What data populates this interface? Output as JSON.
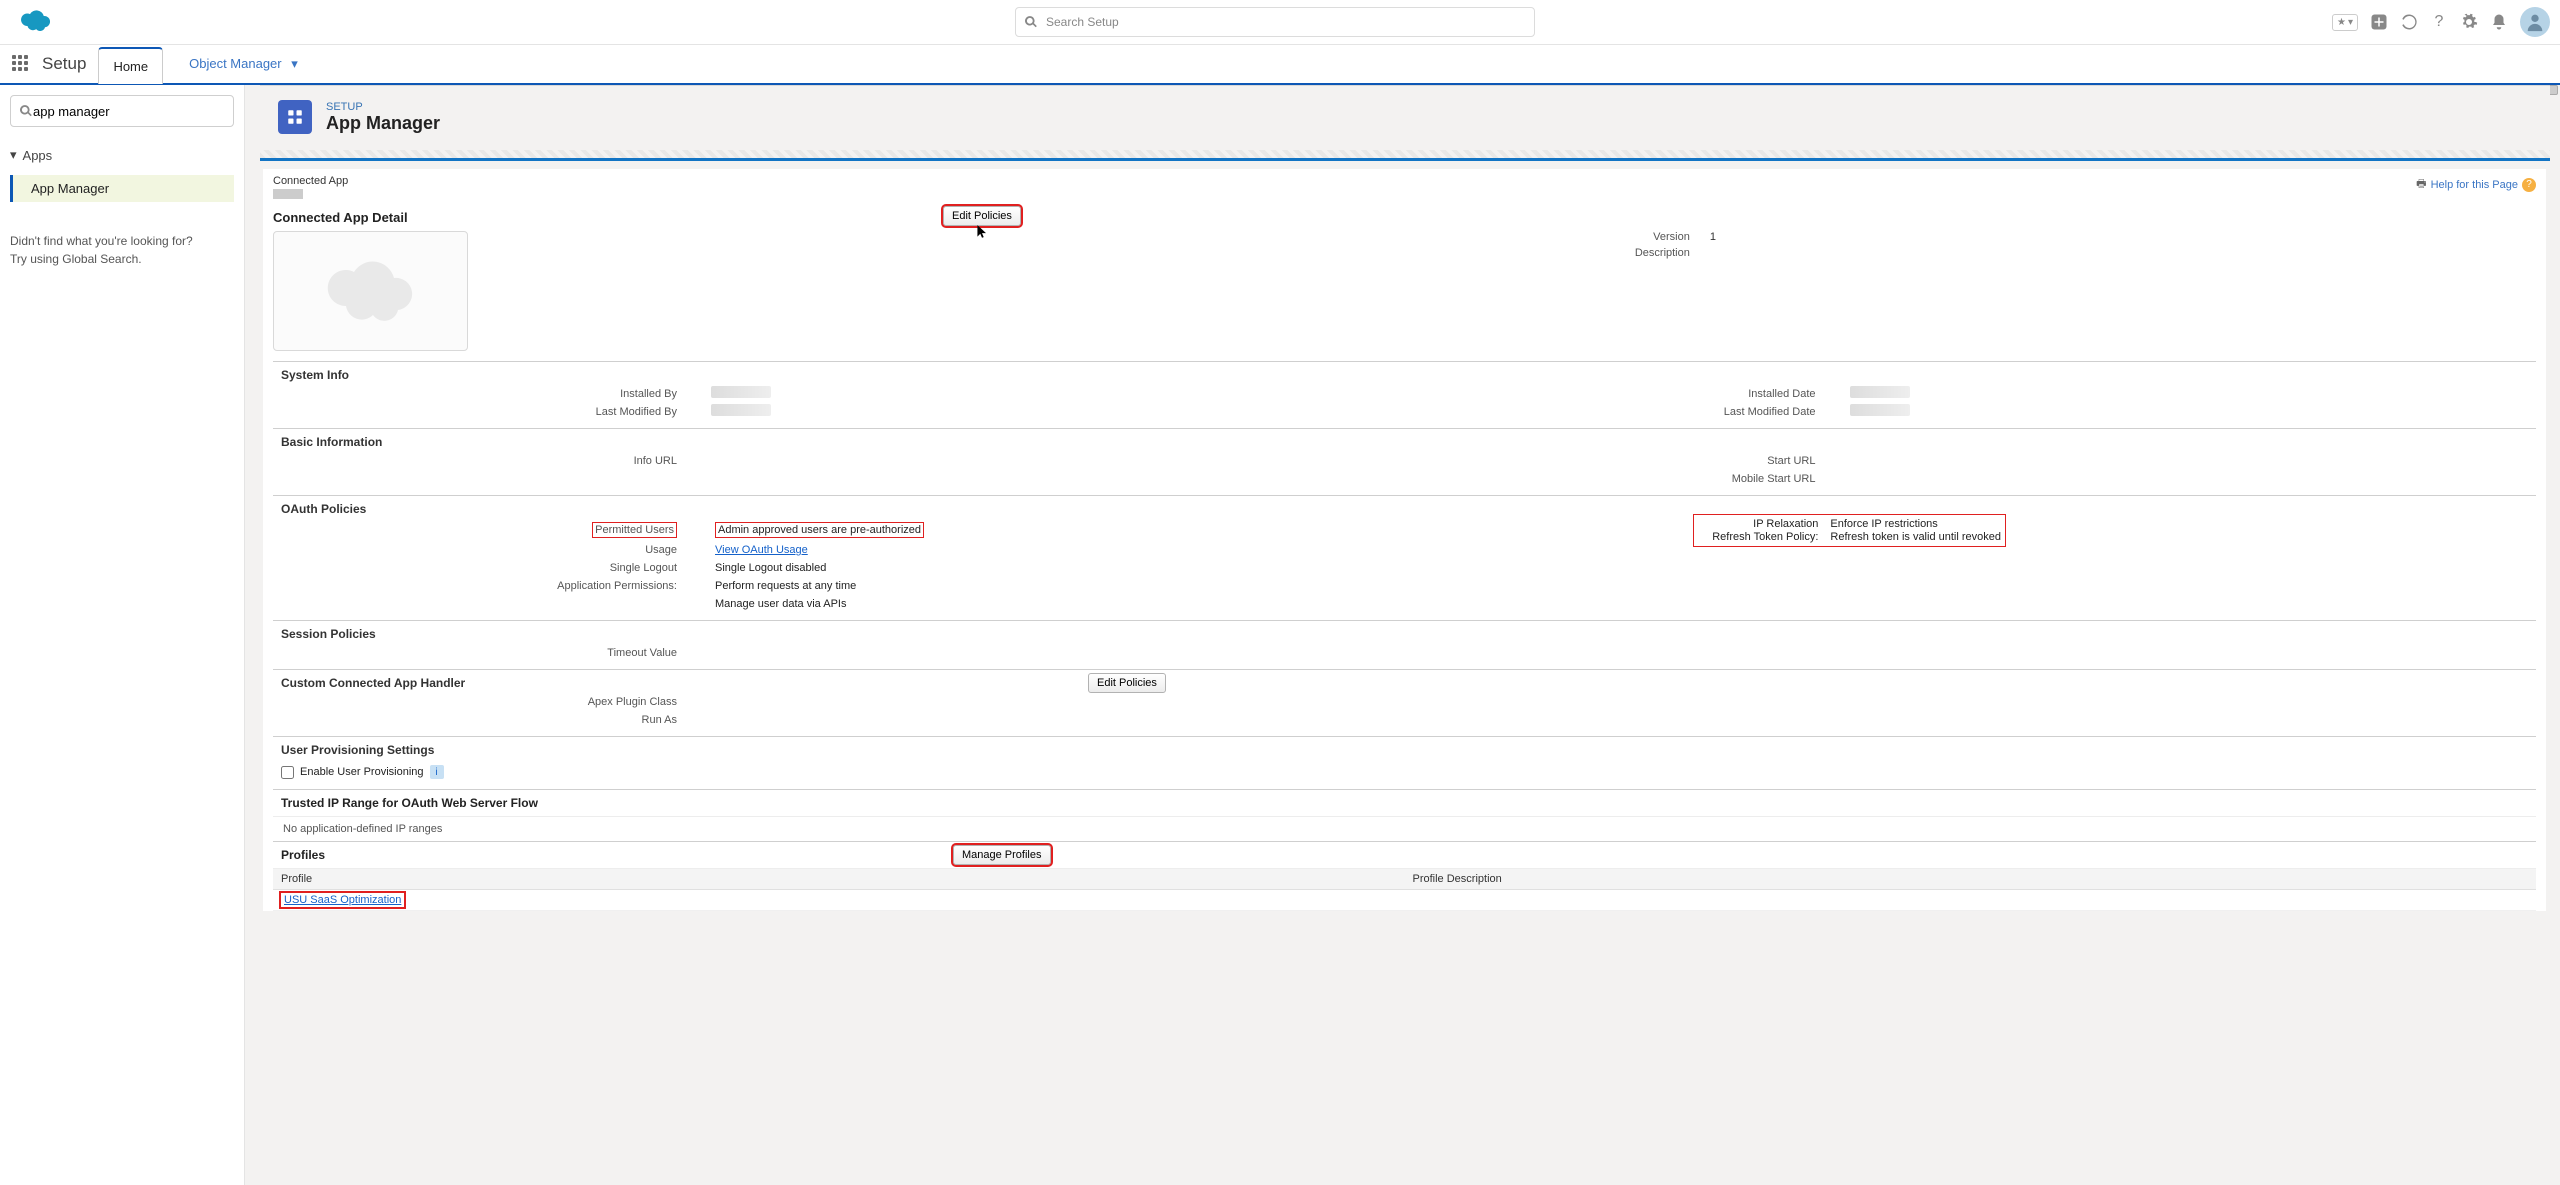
{
  "header": {
    "search_placeholder": "Search Setup"
  },
  "nav": {
    "app_title": "Setup",
    "tab_home": "Home",
    "tab_obj_mgr": "Object Manager"
  },
  "side": {
    "search_value": "app manager",
    "root": "Apps",
    "child": "App Manager",
    "hint1": "Didn't find what you're looking for?",
    "hint2": "Try using Global Search."
  },
  "band": {
    "kicker": "SETUP",
    "title": "App Manager"
  },
  "detail": {
    "type_label": "Connected App",
    "help_label": "Help for this Page",
    "cad_title": "Connected App Detail",
    "edit_policies": "Edit Policies",
    "version_label": "Version",
    "version_value": "1",
    "description_label": "Description"
  },
  "system_info": {
    "title": "System Info",
    "installed_by": "Installed By",
    "last_modified_by": "Last Modified By",
    "installed_date": "Installed Date",
    "last_modified_date": "Last Modified Date"
  },
  "basic_info": {
    "title": "Basic Information",
    "info_url": "Info URL",
    "start_url": "Start URL",
    "mobile_start_url": "Mobile Start URL"
  },
  "oauth": {
    "title": "OAuth Policies",
    "permitted_users_label": "Permitted Users",
    "permitted_users_value": "Admin approved users are pre-authorized",
    "usage_label": "Usage",
    "usage_value": "View OAuth Usage",
    "single_logout_label": "Single Logout",
    "single_logout_value": "Single Logout disabled",
    "app_perms_label": "Application Permissions:",
    "app_perms_v1": "Perform requests at any time",
    "app_perms_v2": "Manage user data via APIs",
    "ip_relax_label": "IP Relaxation",
    "ip_relax_value": "Enforce IP restrictions",
    "refresh_label": "Refresh Token Policy:",
    "refresh_value": "Refresh token is valid until revoked"
  },
  "session": {
    "title": "Session Policies",
    "timeout_label": "Timeout Value"
  },
  "cch": {
    "title": "Custom Connected App Handler",
    "apex_label": "Apex Plugin Class",
    "runas_label": "Run As",
    "edit_policies": "Edit Policies"
  },
  "ups": {
    "title": "User Provisioning Settings",
    "enable_label": "Enable User Provisioning"
  },
  "trusted": {
    "title": "Trusted IP Range for OAuth Web Server Flow",
    "empty_msg": "No application-defined IP ranges"
  },
  "profiles": {
    "title": "Profiles",
    "btn": "Manage Profiles",
    "col1": "Profile",
    "col2": "Profile Description",
    "row1": "USU SaaS Optimization"
  }
}
